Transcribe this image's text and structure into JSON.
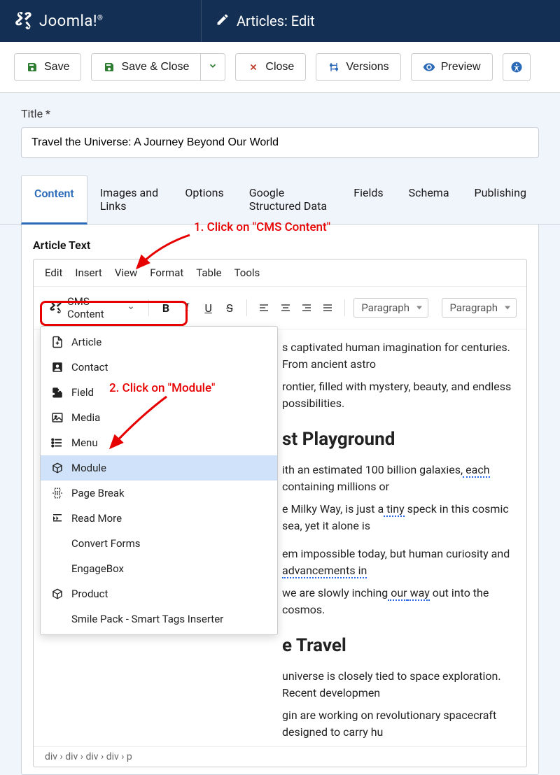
{
  "brand": "Joomla!",
  "pageTitle": "Articles: Edit",
  "toolbar": {
    "save": "Save",
    "saveClose": "Save & Close",
    "close": "Close",
    "versions": "Versions",
    "preview": "Preview"
  },
  "titleField": {
    "label": "Title *",
    "value": "Travel the Universe: A Journey Beyond Our World"
  },
  "tabs": [
    "Content",
    "Images and Links",
    "Options",
    "Google Structured Data",
    "Fields",
    "Schema",
    "Publishing"
  ],
  "activeTab": 0,
  "articleTextLabel": "Article Text",
  "editorMenu": [
    "Edit",
    "Insert",
    "View",
    "Format",
    "Table",
    "Tools"
  ],
  "cmsButton": "CMS Content",
  "formatSelects": [
    "Paragraph",
    "Paragraph"
  ],
  "cmsDropdown": [
    {
      "icon": "doc-plus",
      "label": "Article"
    },
    {
      "icon": "contact",
      "label": "Contact"
    },
    {
      "icon": "puzzle",
      "label": "Field"
    },
    {
      "icon": "media",
      "label": "Media"
    },
    {
      "icon": "menu-lines",
      "label": "Menu"
    },
    {
      "icon": "cube",
      "label": "Module",
      "selected": true
    },
    {
      "icon": "pagebreak",
      "label": "Page Break"
    },
    {
      "icon": "readmore",
      "label": "Read More"
    },
    {
      "icon": "",
      "label": "Convert Forms"
    },
    {
      "icon": "",
      "label": "EngageBox"
    },
    {
      "icon": "cube",
      "label": "Product"
    },
    {
      "icon": "",
      "label": "Smile Pack - Smart Tags Inserter"
    }
  ],
  "annotations": {
    "step1": "1. Click on \"CMS Content\"",
    "step2": "2. Click on \"Module\""
  },
  "articleBody": {
    "intro1": "s captivated human imagination for centuries. From ancient astro",
    "intro2": "rontier, filled with mystery, beauty, and endless possibilities.",
    "h1": "st Playground",
    "p2a": "ith an estimated 100 billion galaxies,",
    "p2b": " each",
    "p2c": " containing millions or",
    "p3a": "e Milky Way, is just a",
    "p3b": " tiny",
    "p3c": " speck in this cosmic sea, yet it alone is",
    "p4a": "em impossible today, but human curiosity and",
    "p4b": " advancements in ",
    "p5a": "we are slowly inching",
    "p5b": " our",
    "p5c": " way",
    "p5d": " out into the cosmos.",
    "h2": "e Travel",
    "p6": "universe is closely tied to space exploration. Recent developmen",
    "p7": "gin are working on revolutionary spacecraft designed to carry hu"
  },
  "breadcrumb": "div › div › div › div › p"
}
